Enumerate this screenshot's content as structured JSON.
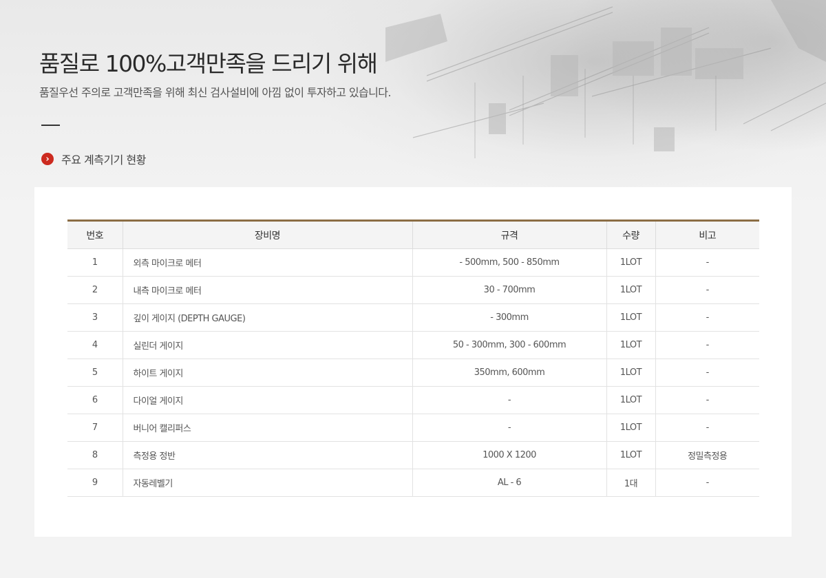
{
  "header": {
    "title": "품질로 100%고객만족을 드리기 위해",
    "subtitle": "품질우선 주의로 고객만족을 위해 최신 검사설비에 아낌 없이 투자하고 있습니다.",
    "section_title": "주요 계측기기 현황",
    "section_icon": "chevron-right-icon"
  },
  "colors": {
    "accent_red": "#cc2a1f",
    "table_top_border": "#8b6d44"
  },
  "table": {
    "headers": {
      "no": "번호",
      "name": "장비명",
      "spec": "규격",
      "qty": "수량",
      "note": "비고"
    },
    "rows": [
      {
        "no": "1",
        "name": "외측 마이크로 메터",
        "spec": "- 500mm, 500 - 850mm",
        "qty": "1LOT",
        "note": "-"
      },
      {
        "no": "2",
        "name": "내측 마이크로 메터",
        "spec": "30 - 700mm",
        "qty": "1LOT",
        "note": "-"
      },
      {
        "no": "3",
        "name": "깊이 게이지 (DEPTH GAUGE)",
        "spec": "- 300mm",
        "qty": "1LOT",
        "note": "-"
      },
      {
        "no": "4",
        "name": "실린더 게이지",
        "spec": "50 - 300mm, 300 - 600mm",
        "qty": "1LOT",
        "note": "-"
      },
      {
        "no": "5",
        "name": "하이트 게이지",
        "spec": "350mm, 600mm",
        "qty": "1LOT",
        "note": "-"
      },
      {
        "no": "6",
        "name": "다이얼 게이지",
        "spec": "-",
        "qty": "1LOT",
        "note": "-"
      },
      {
        "no": "7",
        "name": "버니어 캘리퍼스",
        "spec": "-",
        "qty": "1LOT",
        "note": "-"
      },
      {
        "no": "8",
        "name": "측정용 정반",
        "spec": "1000 X 1200",
        "qty": "1LOT",
        "note": "정밀측정용"
      },
      {
        "no": "9",
        "name": "자동레벨기",
        "spec": "AL - 6",
        "qty": "1대",
        "note": "-"
      }
    ]
  }
}
